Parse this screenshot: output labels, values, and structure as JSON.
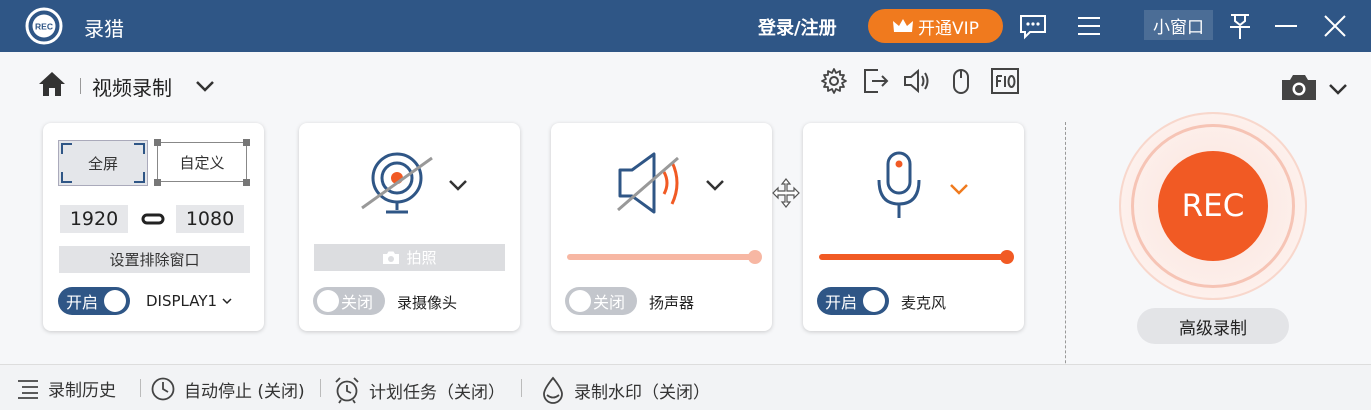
{
  "titlebar": {
    "app_name": "录猎",
    "logo_text": "REC",
    "login": "登录/注册",
    "vip_label": "开通VIP",
    "mini_window": "小窗口"
  },
  "toolbar": {
    "mode_title": "视频录制"
  },
  "screen_card": {
    "full_label": "全屏",
    "custom_label": "自定义",
    "width": "1920",
    "height": "1080",
    "exclude_label": "设置排除窗口",
    "toggle_label": "开启",
    "display_label": "DISPLAY1"
  },
  "camera_card": {
    "photo_label": "拍照",
    "toggle_label": "关闭",
    "device_label": "录摄像头"
  },
  "speaker_card": {
    "toggle_label": "关闭",
    "device_label": "扬声器",
    "volume": 1.0
  },
  "mic_card": {
    "toggle_label": "开启",
    "device_label": "麦克风",
    "volume": 1.0
  },
  "record": {
    "rec_label": "REC",
    "advanced_label": "高级录制"
  },
  "bottombar": {
    "history": "录制历史",
    "auto_stop": "自动停止 (关闭)",
    "schedule": "计划任务（关闭）",
    "watermark": "录制水印（关闭）"
  },
  "colors": {
    "titlebar": "#2f5686",
    "accent": "#f15a24",
    "vip": "#f07a1e",
    "toggle_on": "#2f5686"
  }
}
